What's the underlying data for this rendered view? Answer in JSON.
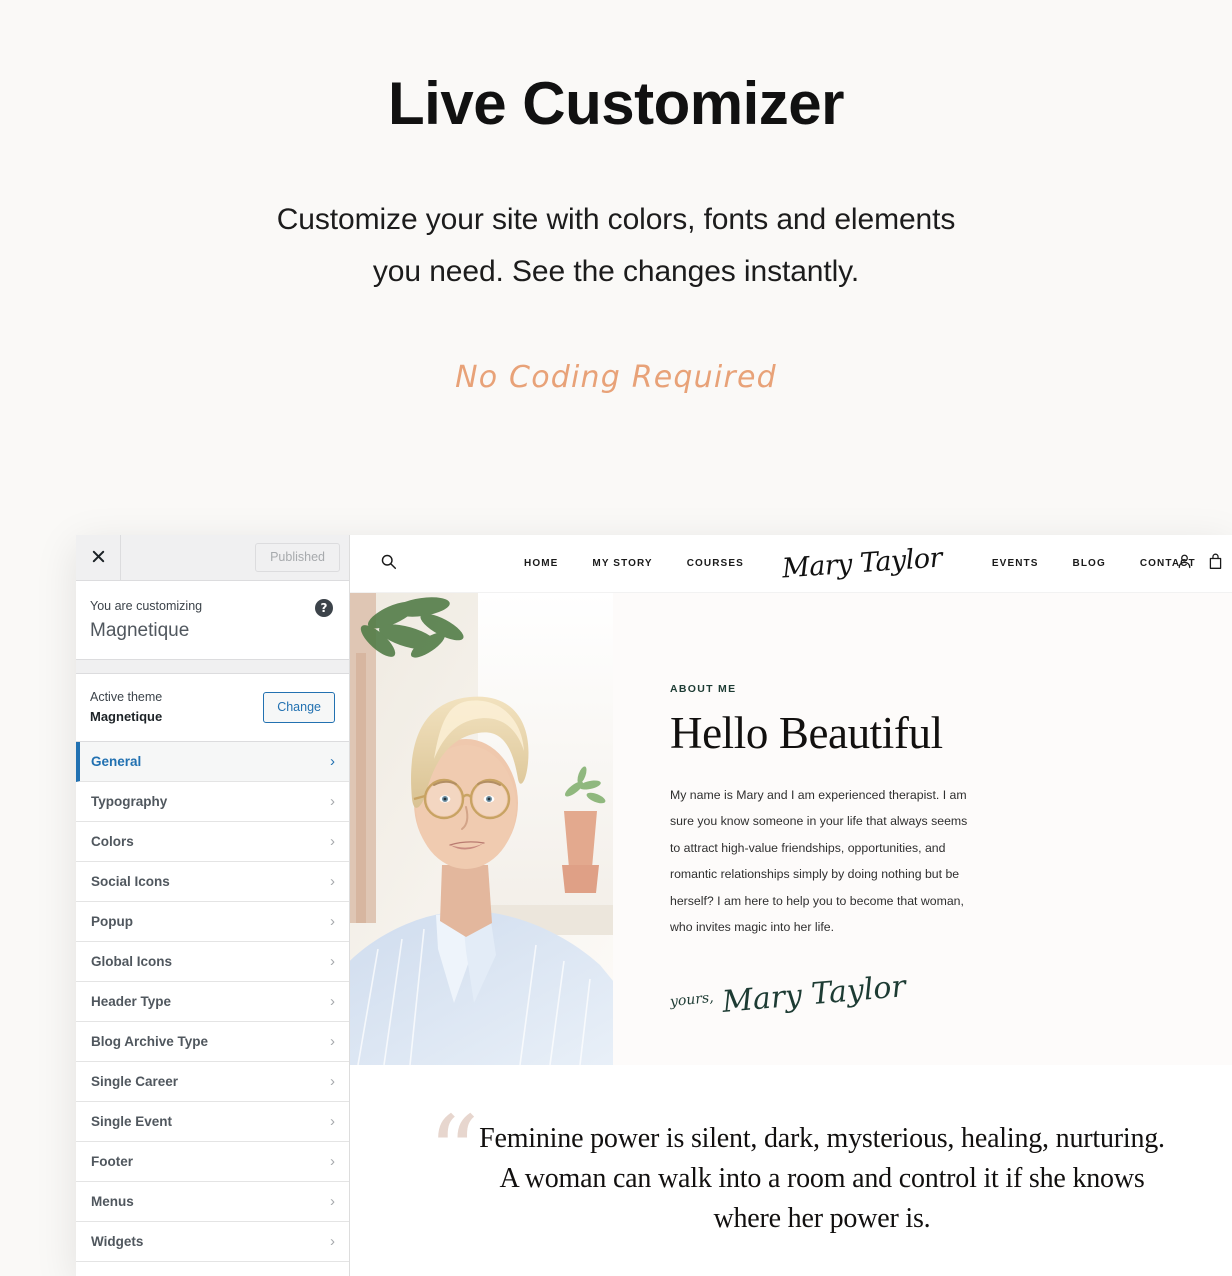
{
  "promo": {
    "title": "Live Customizer",
    "subtitle_line1": "Customize your site with colors, fonts and elements",
    "subtitle_line2": "you need. See the changes instantly.",
    "tagline": "No Coding Required",
    "tagline_color": "#e8a278"
  },
  "customizer": {
    "close_label": "×",
    "publish_label": "Published",
    "publish_disabled": true,
    "help_label": "?",
    "customizing_label": "You are customizing",
    "customizing_theme": "Magnetique",
    "active_theme_label": "Active theme",
    "active_theme_name": "Magnetique",
    "change_label": "Change",
    "accent_color": "#2271b1",
    "menu": [
      {
        "label": "General",
        "active": true
      },
      {
        "label": "Typography",
        "active": false
      },
      {
        "label": "Colors",
        "active": false
      },
      {
        "label": "Social Icons",
        "active": false
      },
      {
        "label": "Popup",
        "active": false
      },
      {
        "label": "Global Icons",
        "active": false
      },
      {
        "label": "Header Type",
        "active": false
      },
      {
        "label": "Blog Archive Type",
        "active": false
      },
      {
        "label": "Single Career",
        "active": false
      },
      {
        "label": "Single Event",
        "active": false
      },
      {
        "label": "Footer",
        "active": false
      },
      {
        "label": "Menus",
        "active": false
      },
      {
        "label": "Widgets",
        "active": false
      }
    ]
  },
  "preview": {
    "nav": {
      "left_links": [
        "HOME",
        "MY STORY",
        "COURSES"
      ],
      "logo": "Mary Taylor",
      "right_links": [
        "EVENTS",
        "BLOG",
        "CONTACT"
      ]
    },
    "about": {
      "eyebrow": "ABOUT ME",
      "heading": "Hello Beautiful",
      "body": "My name is Mary and I am experienced therapist. I am sure you know someone in your life that always seems to attract high-value friendships, opportunities, and romantic relationships simply by doing nothing but be herself? I am here to help you to become that woman, who invites magic into her life.",
      "signature_prefix": "yours,",
      "signature_name": "Mary Taylor",
      "signature_color": "#1d3b33"
    },
    "quote": {
      "mark": "“",
      "mark_color": "#e7d6ce",
      "text": "Feminine power is silent, dark, mysterious, healing, nurturing. A woman can walk into a room and control it if she knows where her power is."
    }
  }
}
